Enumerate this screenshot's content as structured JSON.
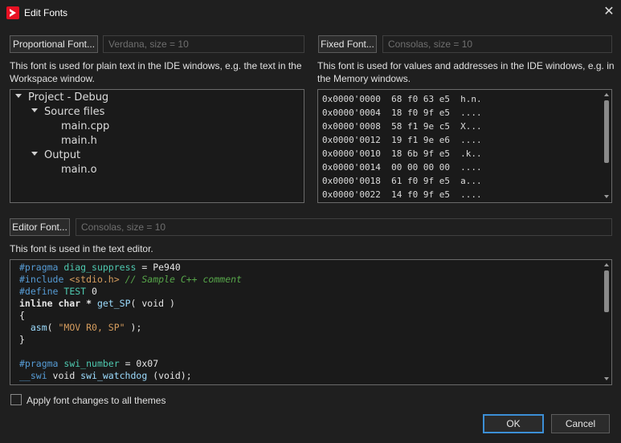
{
  "window": {
    "title": "Edit Fonts",
    "close_glyph": "✕",
    "app_icon": "arrow-app-icon",
    "accent": "#e81123"
  },
  "proportional": {
    "button": "Proportional Font...",
    "value": "Verdana, size = 10",
    "description": "This font is used for plain text in the IDE windows, e.g. the text in the Workspace window.",
    "tree": [
      {
        "label": "Project - Debug",
        "expanded": true
      },
      {
        "label": "Source files",
        "expanded": true
      },
      {
        "label": "main.cpp"
      },
      {
        "label": "main.h"
      },
      {
        "label": "Output",
        "expanded": true
      },
      {
        "label": "main.o"
      }
    ]
  },
  "fixed": {
    "button": "Fixed Font...",
    "value": "Consolas, size = 10",
    "description": "This font is used for values and addresses in the IDE windows, e.g. in the Memory windows.",
    "memory": [
      "0x0000'0000  68 f0 63 e5  h.n.",
      "0x0000'0004  18 f0 9f e5  ....",
      "0x0000'0008  58 f1 9e c5  X...",
      "0x0000'0012  19 f1 9e e6  ....",
      "0x0000'0010  18 6b 9f e5  .k..",
      "0x0000'0014  00 00 00 00  ....",
      "0x0000'0018  61 f0 9f e5  a...",
      "0x0000'0022  14 f0 9f e5  ...."
    ]
  },
  "editor": {
    "button": "Editor Font...",
    "value": "Consolas, size = 10",
    "description": "This font is used in the text editor.",
    "code": {
      "l1_directive": "#pragma",
      "l1_name": "diag_suppress",
      "l1_rest": " = Pe940",
      "l2_directive": "#include",
      "l2_header": "<stdio.h>",
      "l2_comment": "// Sample C++ comment",
      "l3_directive": "#define",
      "l3_name": "TEST",
      "l3_rest": " 0",
      "l4_kw": "inline char *",
      "l4_fn": "get_SP",
      "l4_rest": "( void )",
      "l5": "{",
      "l6_fn": "asm",
      "l6_open": "( ",
      "l6_str": "\"MOV R0, SP\"",
      "l6_close": " );",
      "l7": "}",
      "l9_directive": "#pragma",
      "l9_name": "swi_number",
      "l9_rest": " = 0x07",
      "l10_kw": "__swi",
      "l10_rest1": " void ",
      "l10_fn": "swi_watchdog",
      "l10_rest2": " (void);"
    }
  },
  "apply": {
    "label": "Apply font changes to all themes",
    "checked": false
  },
  "buttons": {
    "ok": "OK",
    "cancel": "Cancel"
  },
  "colors": {
    "ok_border": "#3c8fd6"
  }
}
